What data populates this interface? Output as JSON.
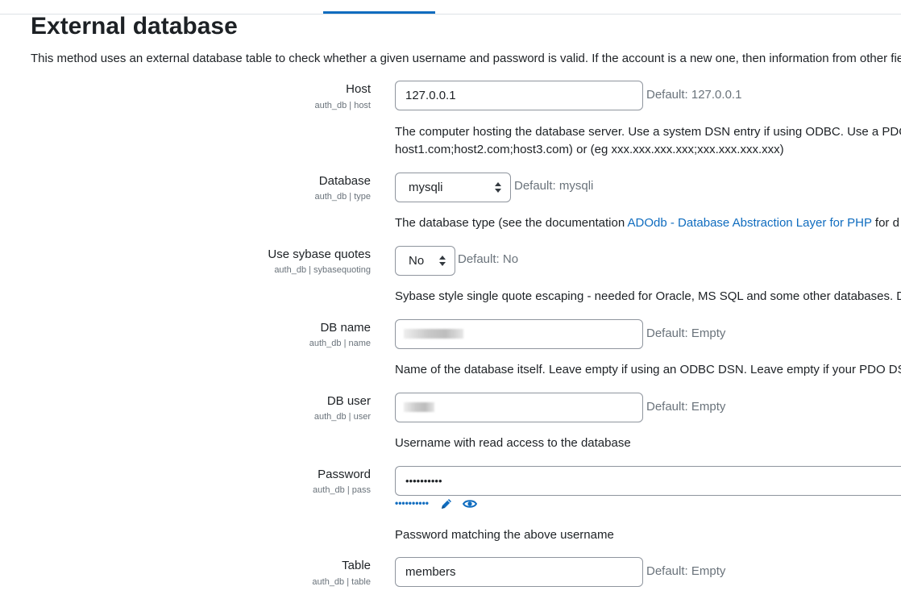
{
  "page": {
    "title": "External database",
    "intro": "This method uses an external database table to check whether a given username and password is valid. If the account is a new one, then information from other fie"
  },
  "settings": {
    "host": {
      "label": "Host",
      "subname": "auth_db | host",
      "value": "127.0.0.1",
      "default": "Default: 127.0.0.1",
      "desc_line1": "The computer hosting the database server. Use a system DSN entry if using ODBC. Use a PDO",
      "desc_line2": "host1.com;host2.com;host3.com) or (eg xxx.xxx.xxx.xxx;xxx.xxx.xxx.xxx)"
    },
    "database": {
      "label": "Database",
      "subname": "auth_db | type",
      "value": "mysqli",
      "default": "Default: mysqli",
      "desc_prefix": "The database type (see the documentation ",
      "desc_link": "ADOdb - Database Abstraction Layer for PHP",
      "desc_suffix": " for d"
    },
    "sybase": {
      "label": "Use sybase quotes",
      "subname": "auth_db | sybasequoting",
      "value": "No",
      "default": "Default: No",
      "desc": "Sybase style single quote escaping - needed for Oracle, MS SQL and some other databases. D"
    },
    "dbname": {
      "label": "DB name",
      "subname": "auth_db | name",
      "default": "Default: Empty",
      "desc": "Name of the database itself. Leave empty if using an ODBC DSN. Leave empty if your PDO DS"
    },
    "dbuser": {
      "label": "DB user",
      "subname": "auth_db | user",
      "default": "Default: Empty",
      "desc": "Username with read access to the database"
    },
    "password": {
      "label": "Password",
      "subname": "auth_db | pass",
      "value": "••••••••••",
      "masked": "••••••••••",
      "edit_icon": "pencil-icon",
      "reveal_icon": "eye-icon",
      "desc": "Password matching the above username"
    },
    "table": {
      "label": "Table",
      "subname": "auth_db | table",
      "value": "members",
      "default": "Default: Empty"
    }
  },
  "colors": {
    "accent": "#0f6cbf",
    "text": "#1d2125",
    "muted": "#6a737b",
    "border": "#8f959e"
  }
}
